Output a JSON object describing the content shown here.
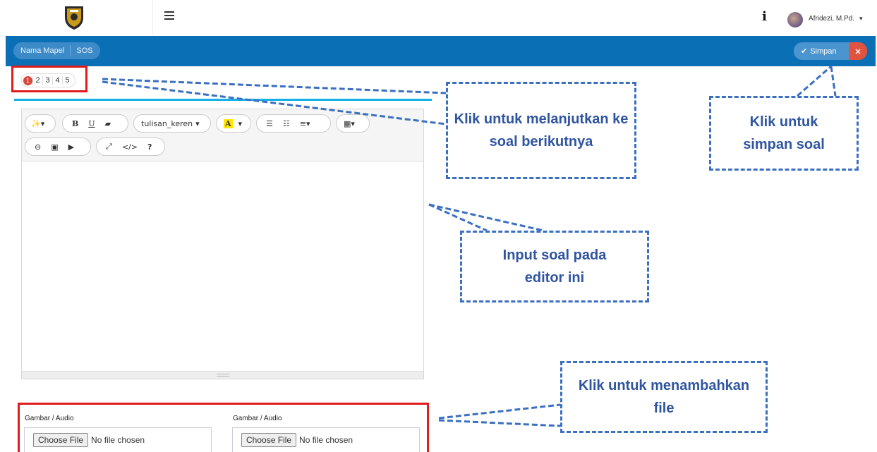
{
  "header": {
    "menu_icon": "hamburger-icon",
    "info_icon": "info-icon",
    "user_name": "Afridezi, M.Pd.",
    "caret": "▾"
  },
  "toolbar_bar": {
    "mapel_label": "Nama Mapel",
    "mapel_value": "SOS",
    "save_label": "Simpan",
    "save_icon": "✔",
    "close_label": "×"
  },
  "pagination": {
    "pages": [
      "1",
      "2",
      "3",
      "4",
      "5"
    ],
    "active": "1"
  },
  "editor": {
    "font_style_label": "tulisan_keren",
    "buttons": [
      "magic-icon",
      "bold",
      "underline",
      "eraser",
      "font-style",
      "font-color",
      "unordered-list",
      "ordered-list",
      "paragraph",
      "table",
      "link",
      "picture",
      "video",
      "fullscreen",
      "codeview",
      "help"
    ]
  },
  "uploads": [
    {
      "label": "Gambar / Audio",
      "button": "Choose File",
      "status": "No file chosen"
    },
    {
      "label": "Gambar / Audio",
      "button": "Choose File",
      "status": "No file chosen"
    }
  ],
  "callouts": {
    "next": "Klik untuk melanjutkan ke soal berikutnya",
    "save": "Klik untuk simpan soal",
    "input": "Input soal pada editor ini",
    "file": "Klik untuk menambahkan file"
  },
  "colors": {
    "bluebar": "#0b6fb5",
    "highlight_red": "#e01b1b",
    "callout_blue": "#3b6fc2"
  }
}
